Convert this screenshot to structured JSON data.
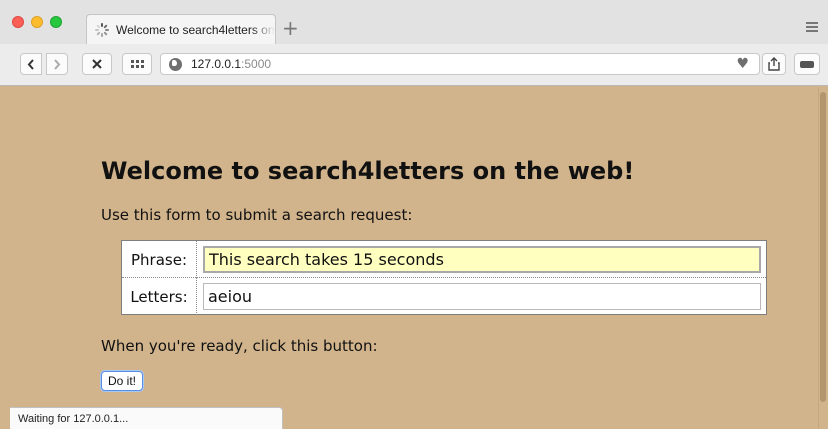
{
  "browser": {
    "tab_title": "Welcome to search4letters on the web!",
    "new_tab_symbol": "+",
    "address": {
      "host": "127.0.0.1",
      "port": ":5000"
    },
    "status_text": "Waiting for 127.0.0.1..."
  },
  "page": {
    "heading": "Welcome to search4letters on the web!",
    "intro": "Use this form to submit a search request:",
    "form": {
      "phrase_label": "Phrase:",
      "phrase_value": "This search takes 15 seconds",
      "letters_label": "Letters:",
      "letters_value": "aeiou"
    },
    "ready_text": "When you're ready, click this button:",
    "submit_label": "Do it!"
  },
  "colors": {
    "page_background": "#d2b48c",
    "focused_field": "#ffffc0",
    "button_focus_ring": "#5a8ee0"
  }
}
